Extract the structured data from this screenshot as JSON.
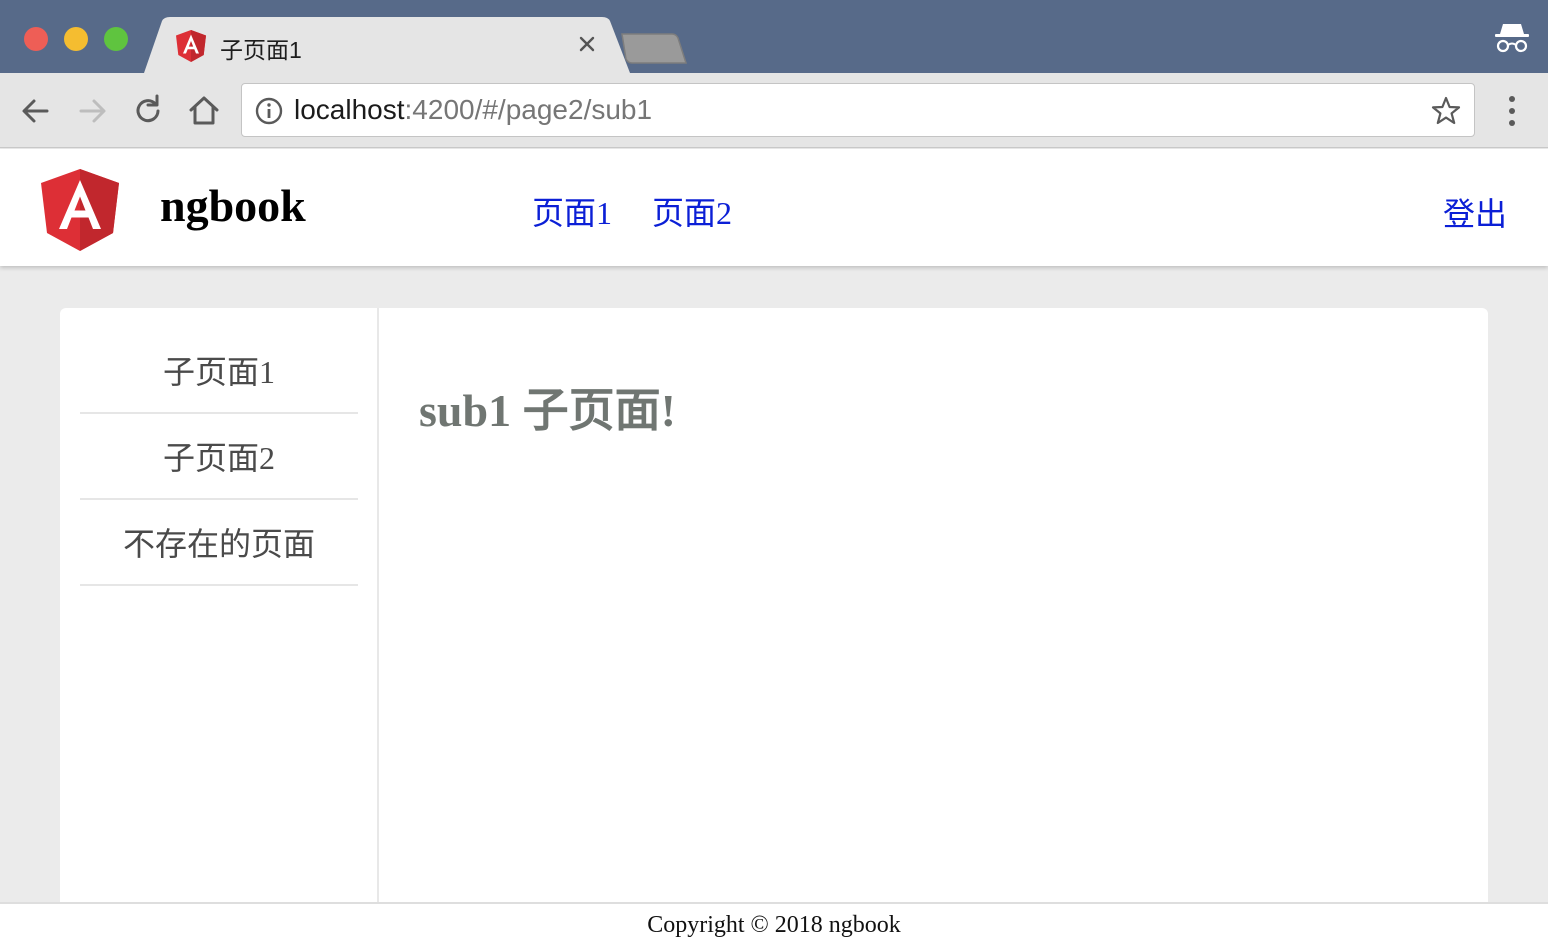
{
  "browser": {
    "tab_title": "子页面1",
    "url_host": "localhost",
    "url_rest": ":4200/#/page2/sub1",
    "colors": {
      "titlebar": "#576a89",
      "toolbar": "#e5e5e5"
    },
    "icons": [
      "angular-favicon-icon",
      "close-icon",
      "incognito-icon",
      "back-icon",
      "forward-icon",
      "reload-icon",
      "home-icon",
      "info-icon",
      "star-icon",
      "menu-icon"
    ]
  },
  "header": {
    "brand": "ngbook",
    "nav": [
      {
        "label": "页面1"
      },
      {
        "label": "页面2"
      }
    ],
    "logout_label": "登出",
    "link_color": "#0b1fd6"
  },
  "sidebar": {
    "items": [
      {
        "label": "子页面1"
      },
      {
        "label": "子页面2"
      },
      {
        "label": "不存在的页面"
      }
    ]
  },
  "main": {
    "title": "sub1 子页面!"
  },
  "footer": {
    "text": "Copyright © 2018 ngbook"
  }
}
